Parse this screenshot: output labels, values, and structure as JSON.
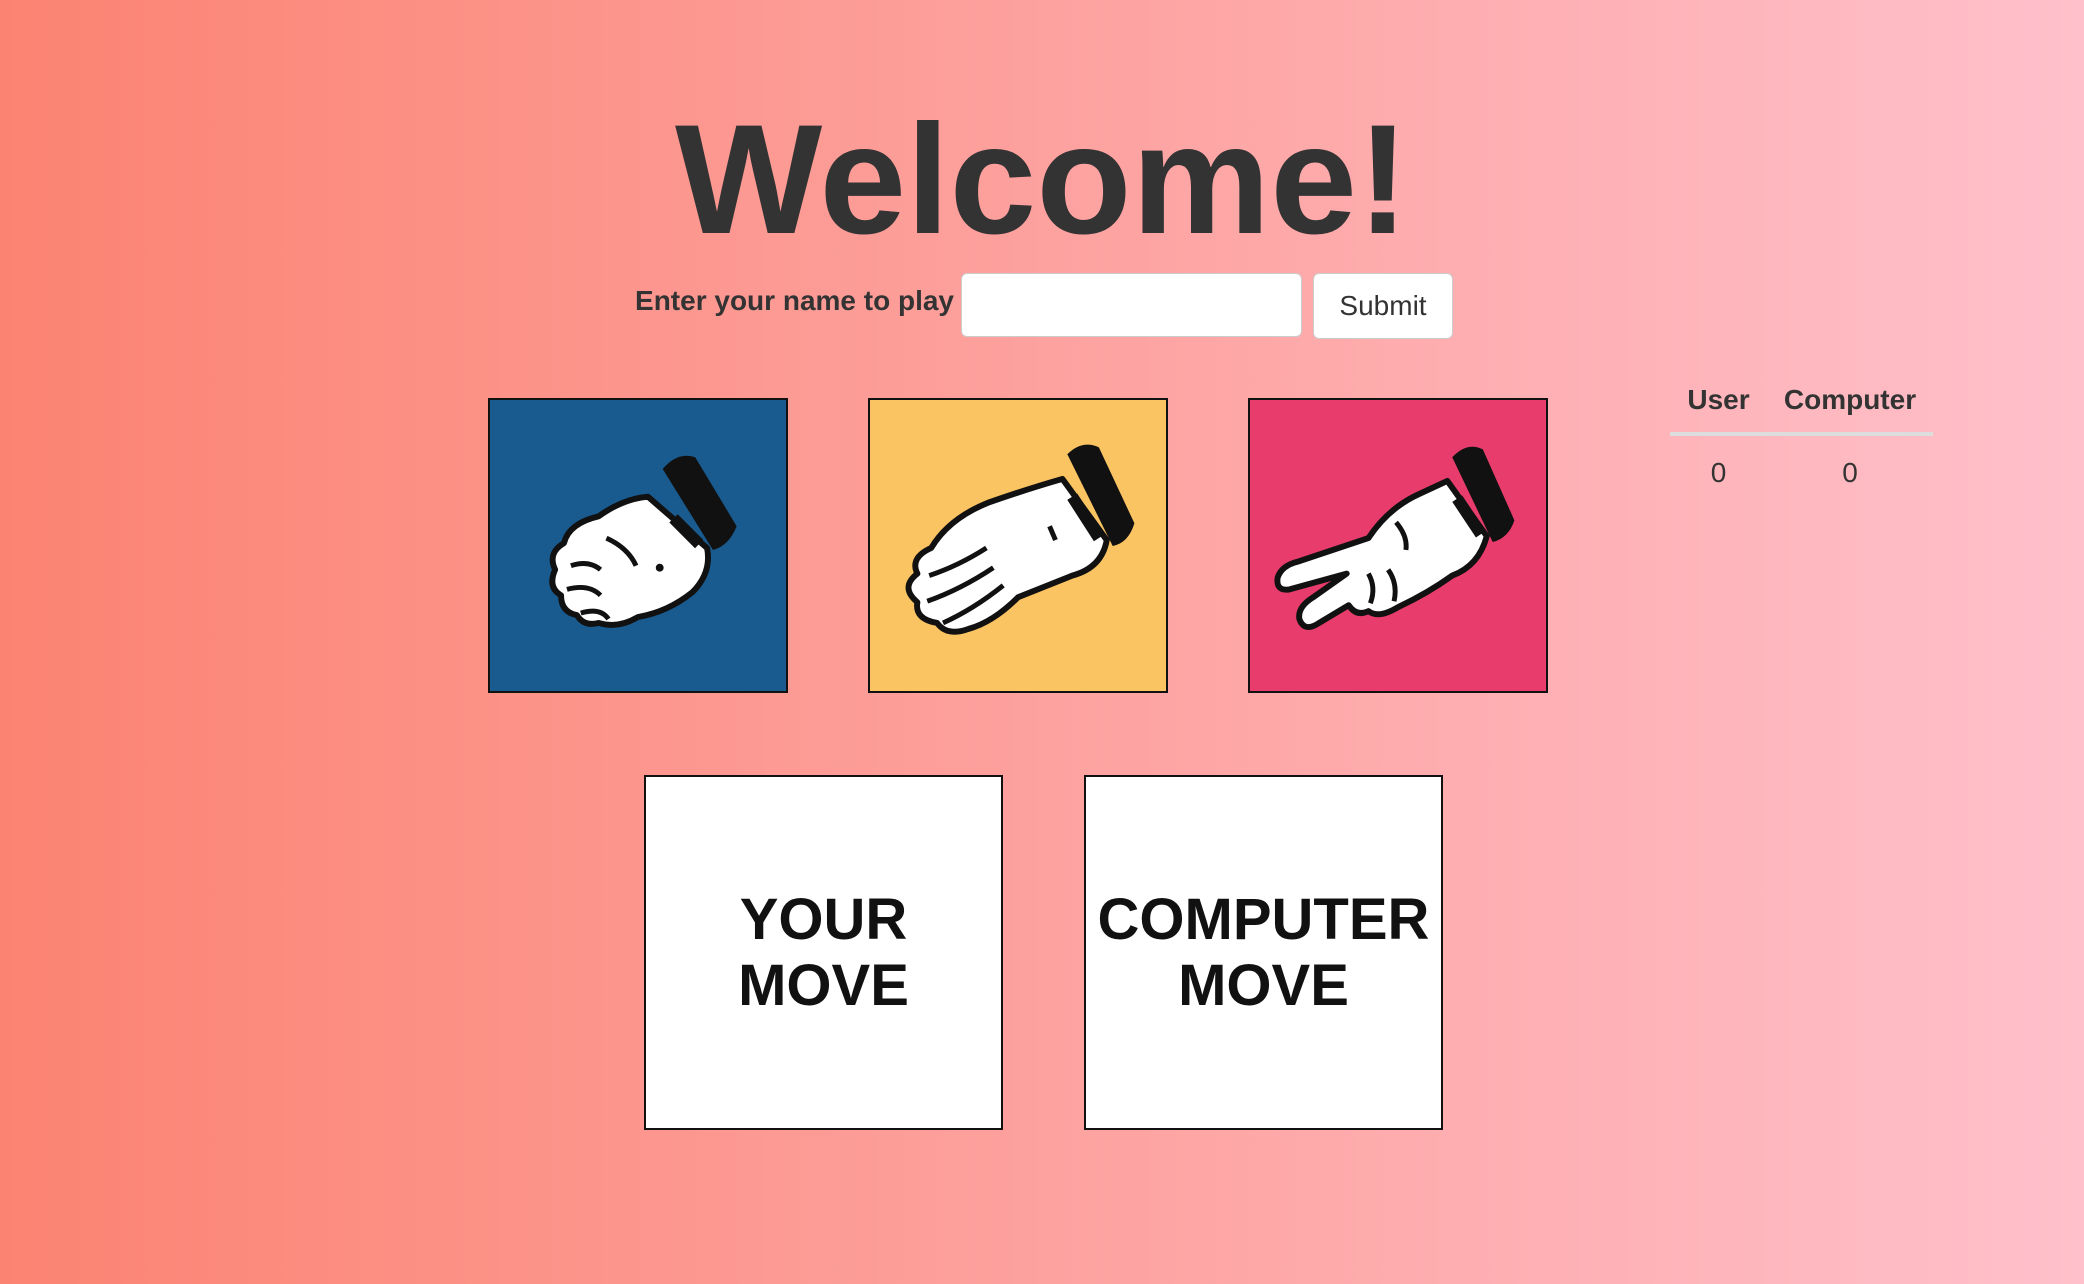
{
  "page": {
    "title": "Welcome!",
    "gradient_start": "#fb8372",
    "gradient_end": "#ffc0cb"
  },
  "name_form": {
    "label": "Enter your name to play",
    "input_value": "",
    "input_placeholder": "",
    "submit_label": "Submit"
  },
  "choices": [
    {
      "name": "rock",
      "icon": "fist-hand-icon",
      "color": "#1a5b8f"
    },
    {
      "name": "paper",
      "icon": "open-hand-icon",
      "color": "#fbc463"
    },
    {
      "name": "scissors",
      "icon": "two-fingers-hand-icon",
      "color": "#e83c6c"
    }
  ],
  "scoreboard": {
    "headers": [
      "User",
      "Computer"
    ],
    "values": [
      "0",
      "0"
    ]
  },
  "moves": {
    "user_line1": "YOUR",
    "user_line2": "MOVE",
    "computer_line1": "COMPUTER",
    "computer_line2": "MOVE"
  }
}
